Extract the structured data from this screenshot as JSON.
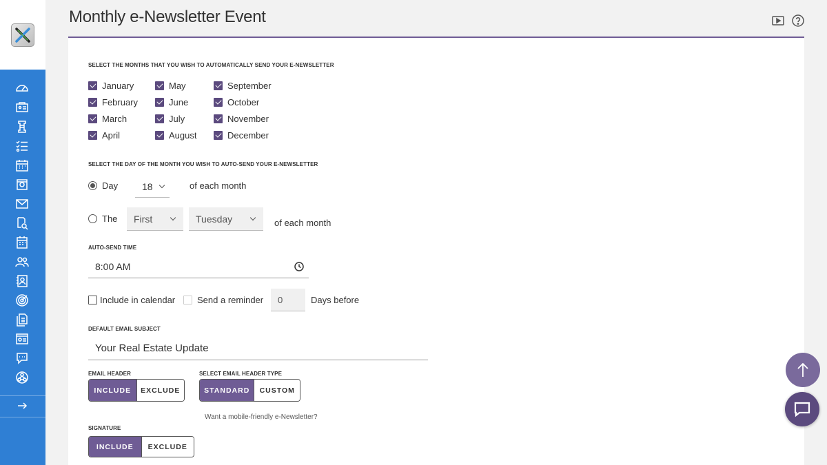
{
  "page": {
    "title": "Monthly e-Newsletter Event"
  },
  "months_section": {
    "label": "SELECT THE MONTHS THAT YOU WISH TO AUTOMATICALLY SEND YOUR E-NEWSLETTER",
    "col1": [
      "January",
      "February",
      "March",
      "April"
    ],
    "col2": [
      "May",
      "June",
      "July",
      "August"
    ],
    "col3": [
      "September",
      "October",
      "November",
      "December"
    ]
  },
  "day_section": {
    "label": "SELECT THE DAY OF THE MONTH YOU WISH TO AUTO-SEND YOUR E-NEWSLETTER",
    "day_label": "Day",
    "day_value": "18",
    "of_each_month": "of each month",
    "the_label": "The",
    "ordinal_value": "First",
    "weekday_value": "Tuesday",
    "of_each_month_2": "of each month"
  },
  "time_section": {
    "label": "AUTO-SEND TIME",
    "value": "8:00 AM"
  },
  "calendar": {
    "include_label": "Include in calendar",
    "reminder_label": "Send a reminder",
    "days_value": "0",
    "days_before": "Days before"
  },
  "subject": {
    "label": "DEFAULT EMAIL SUBJECT",
    "value": "Your Real Estate Update"
  },
  "email_header": {
    "label": "EMAIL HEADER",
    "include": "INCLUDE",
    "exclude": "EXCLUDE"
  },
  "header_type": {
    "label": "SELECT EMAIL HEADER TYPE",
    "standard": "STANDARD",
    "custom": "CUSTOM",
    "mobile_link": "Want a mobile-friendly e-Newsletter?"
  },
  "signature": {
    "label": "SIGNATURE",
    "include": "INCLUDE",
    "exclude": "EXCLUDE"
  },
  "colors": {
    "accent": "#6f5c95",
    "sidebar": "#2f7fd4",
    "checkbox": "#5b4a7e"
  },
  "icons": {
    "sidebar": [
      "dashboard-icon",
      "contacts-icon",
      "tower-icon",
      "list-icon",
      "calendar-icon",
      "photo-icon",
      "mail-icon",
      "search-doc-icon",
      "schedule-icon",
      "people-icon",
      "contact-card-icon",
      "target-icon",
      "documents-icon",
      "id-card-icon",
      "chat-bubble-icon",
      "network-icon"
    ],
    "expand": "arrow-right-icon"
  }
}
